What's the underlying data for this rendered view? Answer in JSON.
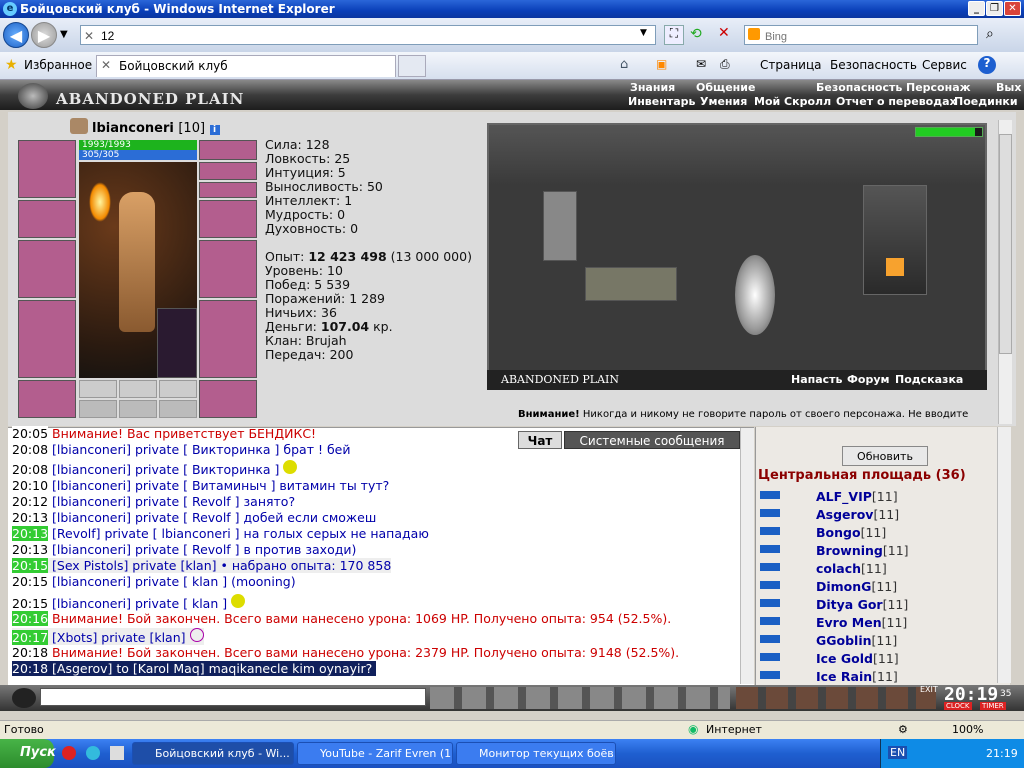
{
  "window": {
    "title": "Бойцовский клуб - Windows Internet Explorer"
  },
  "browser": {
    "address": "12",
    "search_placeholder": "Bing",
    "favorites_label": "Избранное",
    "tab_label": "Бойцовский клуб",
    "menu": [
      "Страница",
      "Безопасность",
      "Сервис"
    ]
  },
  "game": {
    "location_title": "ABANDONED PLAIN",
    "top_menu": [
      "Знания",
      "Общение",
      "Безопасность",
      "Персонаж",
      "Вых"
    ],
    "sub_menu": [
      "Инвентарь",
      "Умения",
      "Мой Скролл",
      "Отчет о переводах",
      "Поединки"
    ],
    "character": {
      "name": "lbianconeri",
      "level": "[10]",
      "hp": "1993/1993",
      "mana": "305/305"
    },
    "stats": [
      {
        "label": "Сила:",
        "value": "128"
      },
      {
        "label": "Ловкость:",
        "value": "25"
      },
      {
        "label": "Интуиция:",
        "value": "5"
      },
      {
        "label": "Выносливость:",
        "value": "50"
      },
      {
        "label": "Интеллект:",
        "value": "1"
      },
      {
        "label": "Мудрость:",
        "value": "0"
      },
      {
        "label": "Духовность:",
        "value": "0"
      }
    ],
    "info": [
      {
        "label": "Опыт:",
        "value": "12 423 498",
        "extra": "(13 000 000)"
      },
      {
        "label": "Уровень:",
        "value": "10",
        "extra": ""
      },
      {
        "label": "Побед:",
        "value": "5 539",
        "extra": ""
      },
      {
        "label": "Поражений:",
        "value": "1 289",
        "extra": ""
      },
      {
        "label": "Ничьих:",
        "value": "36",
        "extra": ""
      },
      {
        "label": "Деньги:",
        "value": "107.04",
        "extra": "кр."
      },
      {
        "label": "Клан:",
        "value": "Brujah",
        "extra": ""
      },
      {
        "label": "Передач:",
        "value": "200",
        "extra": ""
      }
    ],
    "scene_links": [
      "Напасть",
      "Форум",
      "Подсказка"
    ],
    "warning_label": "Внимание!",
    "warning_text": "Никогда и никому не говорите пароль от своего персонажа. Не вводите"
  },
  "chat": {
    "tabs": [
      "Чат",
      "Системные сообщения"
    ],
    "lines": [
      {
        "time": "20:05",
        "text": "Внимание! Вас приветствует БЕНДИКС!"
      },
      {
        "time": "20:08",
        "text": "[lbianconeri] private [ Викторинка ] брат ! бей"
      },
      {
        "time": "20:08",
        "text": "[lbianconeri] private [ Викторинка ]"
      },
      {
        "time": "20:10",
        "text": "[lbianconeri] private [ Витаминыч ] витамин ты тут?"
      },
      {
        "time": "20:12",
        "text": "[lbianconeri] private [ Revolf ] занято?"
      },
      {
        "time": "20:13",
        "text": "[lbianconeri] private [ Revolf ] добей если сможеш"
      },
      {
        "time": "20:13",
        "text": "[Revolf] private [ lbianconeri ] на голых серых не нападаю"
      },
      {
        "time": "20:13",
        "text": "[lbianconeri] private [ Revolf ] в против заходи)"
      },
      {
        "time": "20:15",
        "text": "[Sex Pistols] private [klan] • набрано опыта: 170 858"
      },
      {
        "time": "20:15",
        "text": "[lbianconeri] private [ klan ] (mooning)"
      },
      {
        "time": "20:15",
        "text": "[lbianconeri] private [ klan ]"
      },
      {
        "time": "20:16",
        "text": "Внимание! Бой закончен. Всего вами нанесено урона: 1069 HP. Получено опыта: 954 (52.5%)."
      },
      {
        "time": "20:17",
        "text": "[Xbots] private [klan]"
      },
      {
        "time": "20:18",
        "text": "Внимание! Бой закончен. Всего вами нанесено урона: 2379 HP. Получено опыта: 9148 (52.5%)."
      },
      {
        "time": "20:18",
        "text": "[Asgerov] to [Karol Maq] maqikanecle kim oynayir?"
      }
    ]
  },
  "online": {
    "refresh_label": "Обновить",
    "room": "Центральная площадь (36)",
    "users": [
      {
        "name": "ALF_VIP",
        "level": "[11]"
      },
      {
        "name": "Asgerov",
        "level": "[11]"
      },
      {
        "name": "Bongo",
        "level": "[11]"
      },
      {
        "name": "Browning",
        "level": "[11]"
      },
      {
        "name": "colach",
        "level": "[11]"
      },
      {
        "name": "DimonG",
        "level": "[11]"
      },
      {
        "name": "Dityа Gor",
        "level": "[11]"
      },
      {
        "name": "Evro Men",
        "level": "[11]"
      },
      {
        "name": "GGoblin",
        "level": "[11]"
      },
      {
        "name": "Ice Gold",
        "level": "[11]"
      },
      {
        "name": "Ice Rain",
        "level": "[11]"
      }
    ]
  },
  "clock": {
    "time": "20:19",
    "seconds": "35",
    "clock_label": "CLOCK",
    "timer_label": "TIMER",
    "exit_label": "EXIT"
  },
  "status": {
    "left": "Готово",
    "zone": "Интернет",
    "zoom": "100%"
  },
  "taskbar": {
    "start": "Пуск",
    "tasks": [
      "Бойцовский клуб - Wi...",
      "YouTube - Zarif Evren (1...",
      "Монитор текущих боёв..."
    ],
    "lang": "EN",
    "time": "21:19"
  }
}
